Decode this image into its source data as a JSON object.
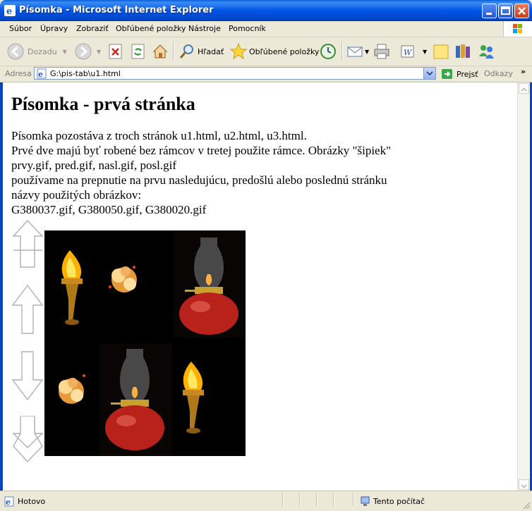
{
  "window": {
    "title": "Písomka - Microsoft Internet Explorer"
  },
  "menu": {
    "items": [
      "Súbor",
      "Úpravy",
      "Zobraziť",
      "Obľúbené položky",
      "Nástroje",
      "Pomocník"
    ]
  },
  "toolbar": {
    "back_label": "Dozadu",
    "search_label": "Hľadať",
    "favorites_label": "Obľúbené položky"
  },
  "address": {
    "label": "Adresa",
    "value": "G:\\pis-tab\\u1.html",
    "go_label": "Prejsť",
    "links_label": "Odkazy"
  },
  "page": {
    "heading": "Písomka - prvá stránka",
    "lines": [
      "Písomka pozostáva z troch stránok u1.html, u2.html, u3.html.",
      "Prvé dve majú byť robené bez rámcov v tretej použite rámce. Obrázky \"šipiek\"",
      "prvy.gif, pred.gif, nasl.gif, posl.gif",
      "používame na prepnutie na prvu nasledujúcu, predošlú alebo poslednú stránku",
      "názvy použitých obrázkov:",
      "G380037.gif, G380050.gif, G380020.gif"
    ]
  },
  "status": {
    "left": "Hotovo",
    "zone": "Tento počítač"
  },
  "colors": {
    "title_bar": "#0055e5",
    "chrome": "#ece9d8",
    "link_area": "#ffffff"
  }
}
